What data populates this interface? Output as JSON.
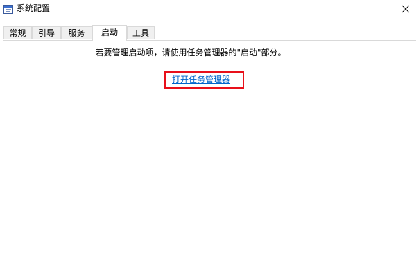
{
  "window": {
    "title": "系统配置",
    "app_icon": "msconfig-icon",
    "close_icon": "close-icon"
  },
  "tabs": [
    {
      "label": "常规",
      "active": false
    },
    {
      "label": "引导",
      "active": false
    },
    {
      "label": "服务",
      "active": false
    },
    {
      "label": "启动",
      "active": true
    },
    {
      "label": "工具",
      "active": false
    }
  ],
  "startup": {
    "message": "若要管理启动项，请使用任务管理器的\"启动\"部分。",
    "link_label": "打开任务管理器"
  },
  "colors": {
    "link": "#0066cc",
    "highlight": "#e8101a",
    "tab_inactive_bg": "#f0f0f0",
    "border": "#d9d9d9"
  }
}
